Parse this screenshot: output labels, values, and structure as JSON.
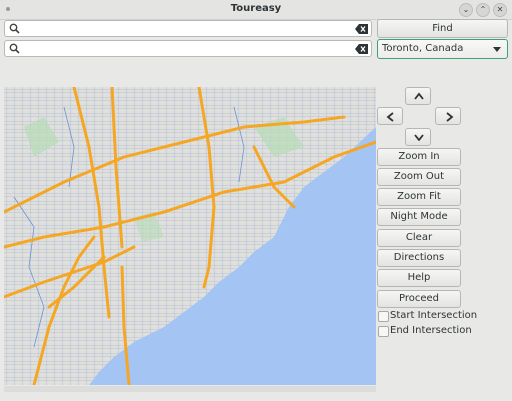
{
  "window": {
    "title": "Toureasy"
  },
  "search": {
    "field1_value": "",
    "field2_value": ""
  },
  "find": {
    "label": "Find"
  },
  "city": {
    "selected": "Toronto, Canada"
  },
  "controls": [
    {
      "key": "zoom_in",
      "label": "Zoom In"
    },
    {
      "key": "zoom_out",
      "label": "Zoom Out"
    },
    {
      "key": "zoom_fit",
      "label": "Zoom Fit"
    },
    {
      "key": "night_mode",
      "label": "Night Mode"
    },
    {
      "key": "clear",
      "label": "Clear"
    },
    {
      "key": "directions",
      "label": "Directions"
    },
    {
      "key": "help",
      "label": "Help"
    },
    {
      "key": "proceed",
      "label": "Proceed"
    }
  ],
  "checkboxes": [
    {
      "label": "Start Intersection",
      "checked": false
    },
    {
      "label": "End Intersection",
      "checked": false
    }
  ],
  "colors": {
    "water": "#a4c4f4",
    "land": "#dedcd6",
    "highway": "#f5a623",
    "minor_road": "#6b93d6",
    "park": "#b6dcb6",
    "accent": "#3f9f77"
  }
}
